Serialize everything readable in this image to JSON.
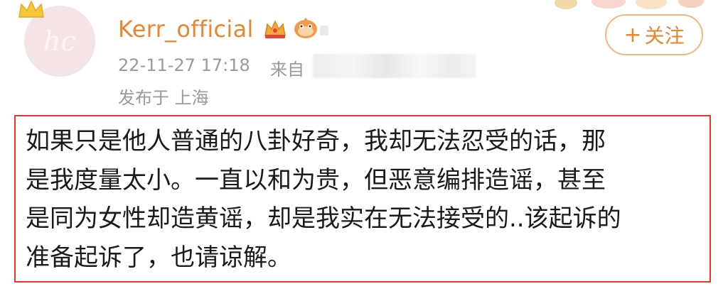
{
  "post": {
    "avatar_initials": "hc",
    "username": "Kerr_official",
    "timestamp": "22-11-27 17:18",
    "source_prefix": "来自",
    "location": "发布于 上海",
    "follow_label": "关注",
    "follow_icon": "plus-icon",
    "content_lines": [
      "如果只是他人普通的八卦好奇，我却无法忍受的话，那",
      "是我度量太小。一直以和为贵，但恶意编排造谣，甚至",
      "是同为女性却造黄谣，却是我实在无法接受的..该起诉的",
      "准备起诉了，也请谅解。"
    ]
  },
  "colors": {
    "username": "#e8862e",
    "meta": "#9a9a9a",
    "follow_border": "#f4b57c",
    "highlight_box": "#e8372f",
    "avatar_bg": "#f4e4e6"
  }
}
